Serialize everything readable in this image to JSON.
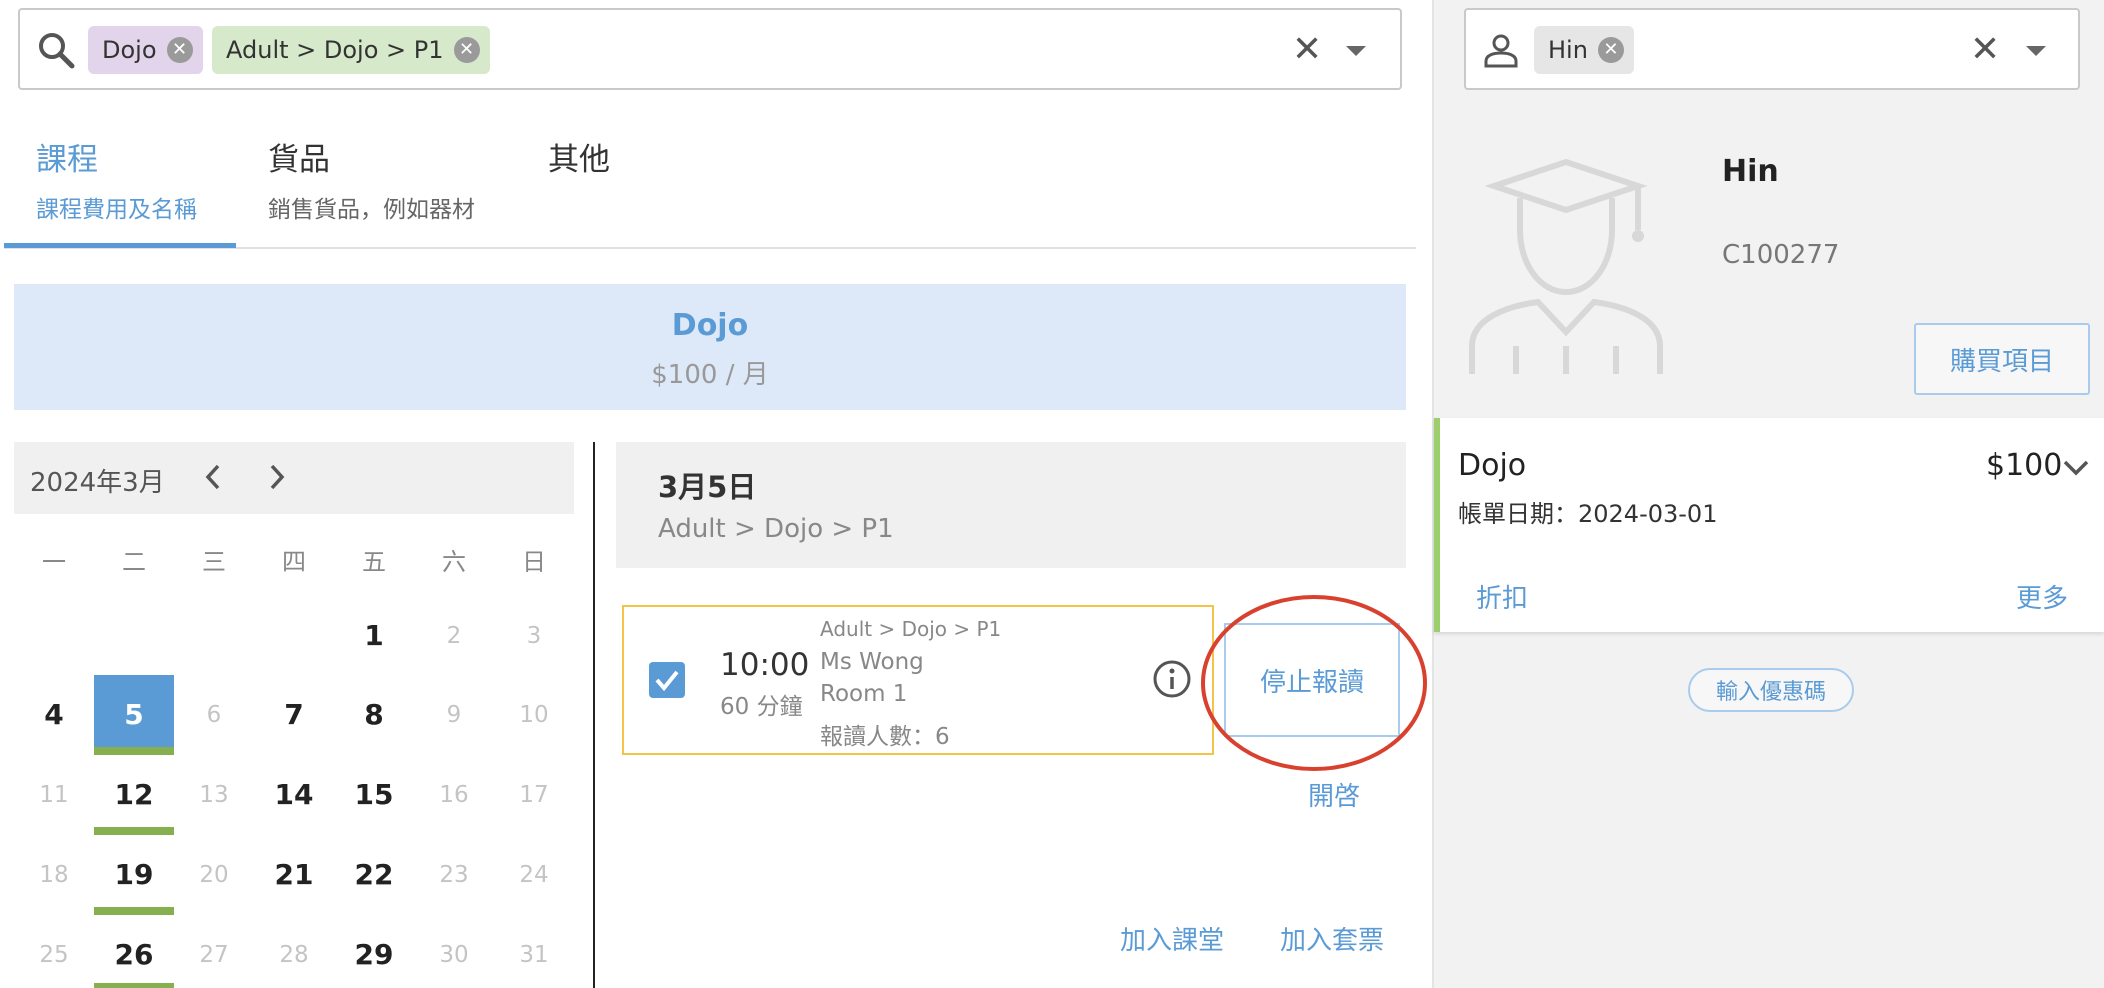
{
  "search": {
    "chips": [
      {
        "label": "Dojo"
      },
      {
        "label": "Adult > Dojo > P1"
      }
    ]
  },
  "student_search": {
    "chips": [
      {
        "label": "Hin"
      }
    ]
  },
  "tabs": [
    {
      "title": "課程",
      "subtitle": "課程費用及名稱"
    },
    {
      "title": "貨品",
      "subtitle": "銷售貨品，例如器材"
    },
    {
      "title": "其他",
      "subtitle": ""
    }
  ],
  "course_banner": {
    "name": "Dojo",
    "price": "$100 / 月"
  },
  "calendar": {
    "month_label": "2024年3月",
    "weekdays": [
      "一",
      "二",
      "三",
      "四",
      "五",
      "六",
      "日"
    ],
    "weeks": [
      [
        null,
        null,
        null,
        null,
        "1",
        "2",
        "3"
      ],
      [
        "4",
        "5",
        "6",
        "7",
        "8",
        "9",
        "10"
      ],
      [
        "11",
        "12",
        "13",
        "14",
        "15",
        "16",
        "17"
      ],
      [
        "18",
        "19",
        "20",
        "21",
        "22",
        "23",
        "24"
      ],
      [
        "25",
        "26",
        "27",
        "28",
        "29",
        "30",
        "31"
      ]
    ]
  },
  "day_detail": {
    "date": "3月5日",
    "path": "Adult > Dojo > P1"
  },
  "session": {
    "time": "10:00",
    "duration": "60 分鐘",
    "path": "Adult > Dojo > P1",
    "teacher": "Ms Wong",
    "room": "Room 1",
    "enrolled": "報讀人數：6",
    "stop_label": "停止報讀",
    "open_label": "開啓"
  },
  "actions": {
    "add_class": "加入課堂",
    "add_package": "加入套票"
  },
  "student": {
    "name": "Hin",
    "id": "C100277",
    "buy_label": "購買項目"
  },
  "order_item": {
    "name": "Dojo",
    "price": "$100",
    "bill_date": "帳單日期：2024-03-01",
    "discount_label": "折扣",
    "more_label": "更多"
  },
  "coupon_label": "輸入優惠碼",
  "colors": {
    "accent": "#5b9bd5",
    "banner_bg": "#dde9f8",
    "chip_purple": "#e2d4ea",
    "chip_green": "#d6e9cb",
    "highlight_orange": "#f5c34a",
    "annotation_red": "#d9412f",
    "green_marker": "#86b04f"
  }
}
